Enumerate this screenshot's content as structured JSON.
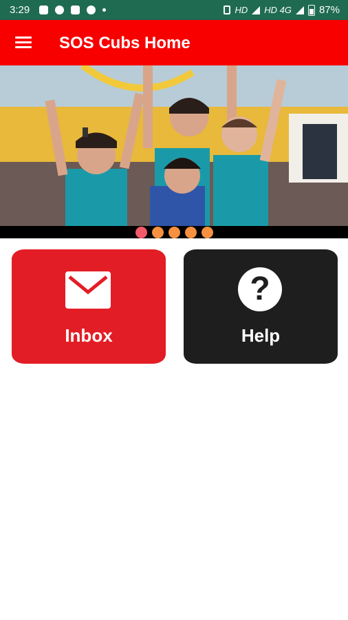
{
  "status_bar": {
    "time": "3:29",
    "network_label_1": "HD",
    "network_label_2": "HD 4G",
    "battery": "87%"
  },
  "app_bar": {
    "title": "SOS Cubs Home",
    "menu_icon": "hamburger-menu-icon"
  },
  "banner": {
    "pager_dots": 5,
    "active_dot": 0
  },
  "tiles": [
    {
      "label": "Inbox",
      "icon": "envelope-icon",
      "color": "#e31d25"
    },
    {
      "label": "Help",
      "icon": "question-mark-icon",
      "color": "#1e1e1e"
    }
  ],
  "colors": {
    "status_bar": "#1f6b51",
    "app_bar": "#f80000",
    "dot_active": "#f4596a",
    "dot_inactive": "#f59140"
  }
}
